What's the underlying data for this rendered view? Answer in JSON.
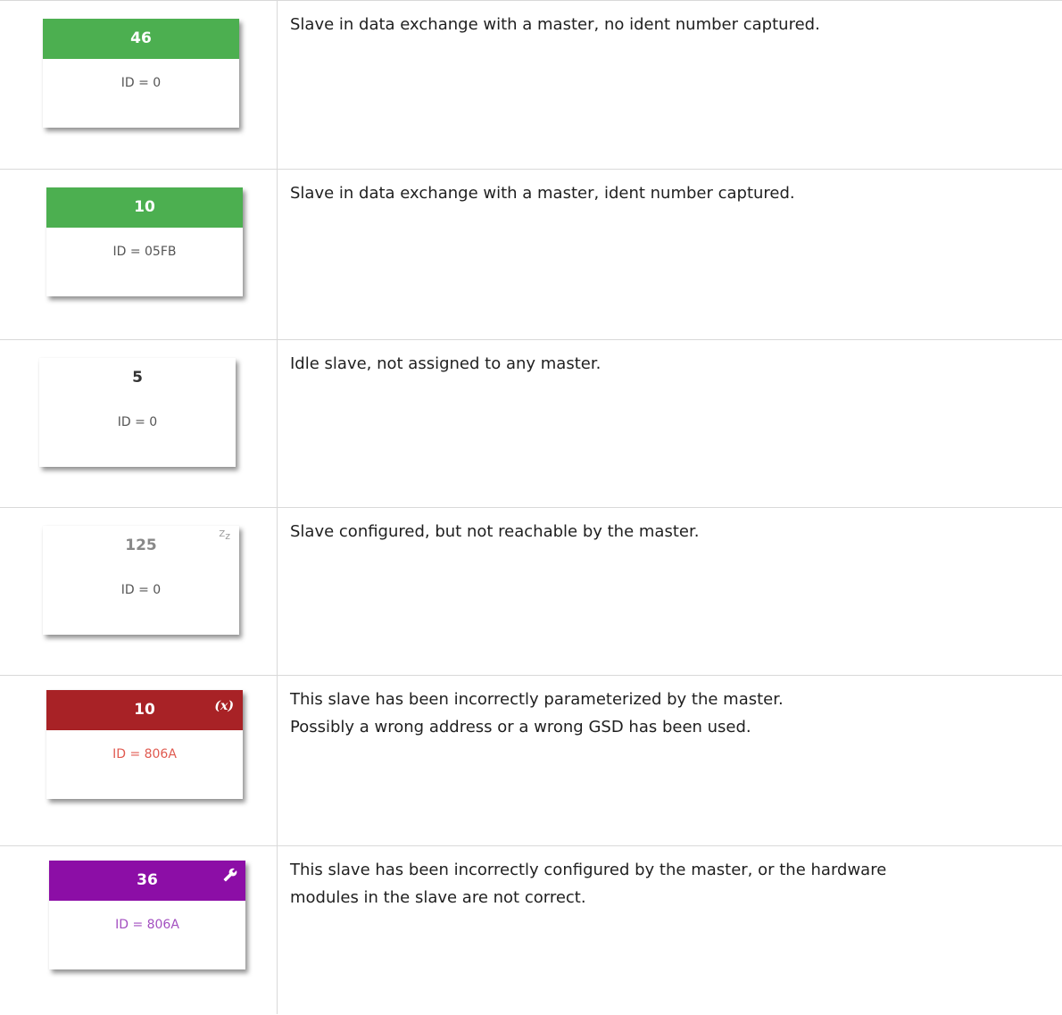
{
  "rows": [
    {
      "card": {
        "number": "46",
        "ident": "ID = 0",
        "header_color": "#4caf50"
      },
      "description": [
        "Slave in data exchange with a master, no ident number captured."
      ]
    },
    {
      "card": {
        "number": "10",
        "ident": "ID = 05FB",
        "header_color": "#4caf50"
      },
      "description": [
        "Slave in data exchange with a master, ident number captured."
      ]
    },
    {
      "card": {
        "number": "5",
        "ident": "ID = 0",
        "header_color": "#ffffff"
      },
      "description": [
        "Idle slave, not assigned to any master."
      ]
    },
    {
      "card": {
        "number": "125",
        "ident": "ID = 0",
        "header_color": "#ffffff",
        "icon": "sleep-icon",
        "icon_text": "Zz"
      },
      "description": [
        "Slave configured, but not reachable by the master."
      ]
    },
    {
      "card": {
        "number": "10",
        "ident": "ID = 806A",
        "header_color": "#a82226",
        "icon": "parameter-error-icon",
        "icon_text": "(x)"
      },
      "description": [
        "This slave has been incorrectly parameterized by the master.",
        "Possibly a wrong address or a wrong GSD has been used."
      ]
    },
    {
      "card": {
        "number": "36",
        "ident": "ID = 806A",
        "header_color": "#8c0ea6",
        "icon": "wrench-icon"
      },
      "description": [
        "This slave has been incorrectly configured by the master, or the hardware",
        "modules in the slave are not correct."
      ]
    }
  ]
}
